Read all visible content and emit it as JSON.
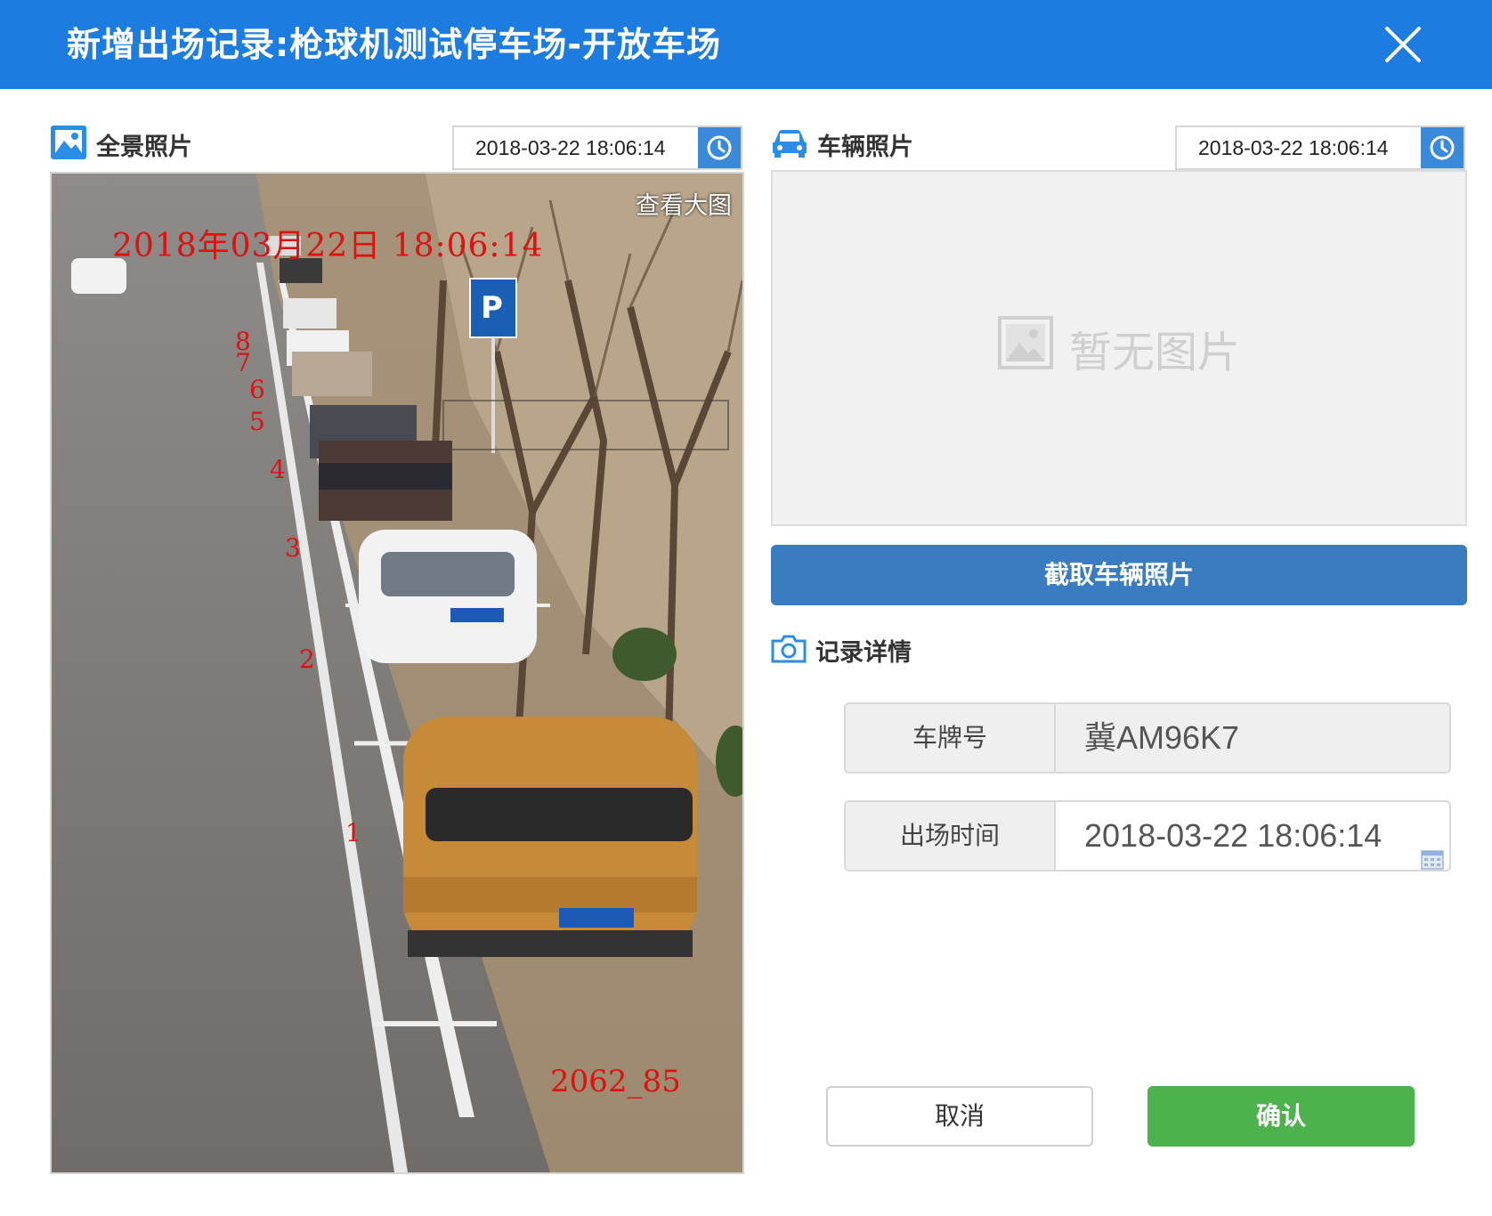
{
  "dialog": {
    "title": "新增出场记录:枪球机测试停车场-开放车场",
    "close_icon": "close-icon"
  },
  "panorama": {
    "label": "全景照片",
    "icon": "image-icon",
    "time": "2018-03-22 18:06:14",
    "time_button_icon": "clock-icon",
    "view_large": "查看大图",
    "overlay_time": "2018年03月22日 18:06:14",
    "overlay_code": "2062_85"
  },
  "vehicle": {
    "label": "车辆照片",
    "icon": "car-icon",
    "time": "2018-03-22 18:06:14",
    "time_button_icon": "clock-icon",
    "no_image_text": "暂无图片",
    "capture_button": "截取车辆照片"
  },
  "details": {
    "label": "记录详情",
    "icon": "camera-icon",
    "plate_label": "车牌号",
    "plate_value": "冀AM96K7",
    "exit_time_label": "出场时间",
    "exit_time_value": "2018-03-22 18:06:14",
    "calendar_icon": "calendar-icon"
  },
  "actions": {
    "cancel": "取消",
    "confirm": "确认"
  },
  "colors": {
    "header": "#1c7ce0",
    "primary_button": "#3a7cc1",
    "confirm_button": "#4cb34c",
    "overlay_text": "#e01010"
  }
}
